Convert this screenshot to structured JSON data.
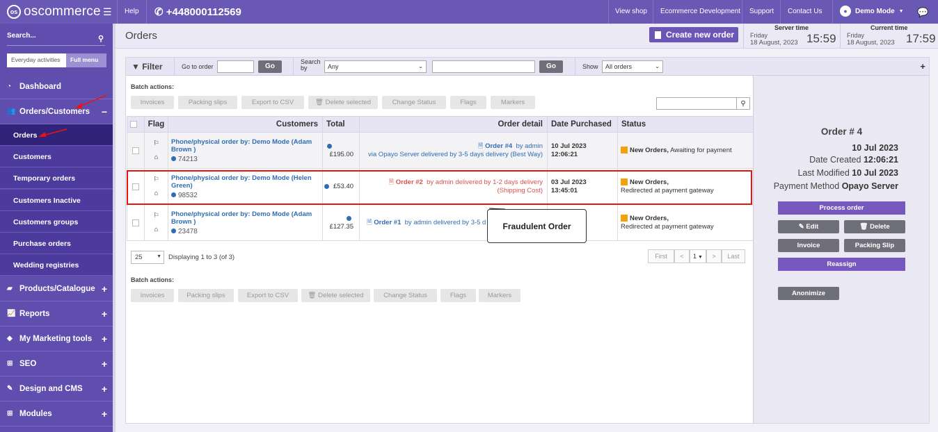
{
  "topbar": {
    "brand": "oscommerce",
    "help": "Help",
    "phone": "+448000112569",
    "links": [
      "View shop",
      "Ecommerce Development",
      "Support",
      "Contact Us"
    ],
    "user": "Demo Mode"
  },
  "sidebar": {
    "search_label": "Search...",
    "tabs": [
      "Everyday activities",
      "Full menu"
    ],
    "dashboard": "Dashboard",
    "orders_customers": "Orders/Customers",
    "subitems": [
      "Orders",
      "Customers",
      "Temporary orders",
      "Customers Inactive",
      "Customers groups",
      "Purchase orders",
      "Wedding registries"
    ],
    "sections": [
      "Products/Catalogue",
      "Reports",
      "My Marketing tools",
      "SEO",
      "Design and CMS",
      "Modules"
    ]
  },
  "header": {
    "title": "Orders",
    "create_button": "Create new order",
    "server_time": {
      "label": "Server time",
      "day": "Friday",
      "date": "18 August, 2023",
      "time": "15:59"
    },
    "current_time": {
      "label": "Current time",
      "day": "Friday",
      "date": "18 August, 2023",
      "time": "17:59"
    }
  },
  "filter": {
    "label": "Filter",
    "go_to_order": "Go to order",
    "go": "Go",
    "search_by_line1": "Search",
    "search_by_line2": "by",
    "search_by_value": "Any",
    "show": "Show",
    "show_value": "All orders"
  },
  "batch": {
    "label": "Batch actions:",
    "buttons": [
      "Invoices",
      "Packing slips",
      "Export to CSV",
      "Delete selected",
      "Change Status",
      "Flags",
      "Markers"
    ]
  },
  "table": {
    "headers": [
      "Flag",
      "Customers",
      "Total",
      "Order detail",
      "Date Purchased",
      "Status"
    ],
    "rows": [
      {
        "cust1": "Phone/physical order by: Demo Mode (Adam",
        "cust2": "Brown )",
        "cust_id": "74213",
        "total": "£195.00",
        "order_no": "Order #4",
        "detail1": "by admin",
        "detail2": "via Opayo Server delivered by 3-5 days delivery (Best Way)",
        "date": "10 Jul 2023",
        "time": "12:06:21",
        "status": "New Orders,",
        "status_note": "Awaiting for payment"
      },
      {
        "cust1": "Phone/physical order by: Demo Mode (Helen",
        "cust2": "Green)",
        "cust_id": "98532",
        "total": "£53.40",
        "order_no": "Order #2",
        "detail1": "by admin delivered by 1-2 days delivery",
        "detail2": "(Shipping Cost)",
        "date": "03 Jul 2023",
        "time": "13:45:01",
        "status": "New Orders,",
        "status_note": "Redirected at payment gateway"
      },
      {
        "cust1": "Phone/physical order by: Demo Mode (Adam",
        "cust2": "Brown )",
        "cust_id": "23478",
        "total": "£127.35",
        "order_no": "Order #1",
        "detail1": "by admin delivered by 3-5 d",
        "detail2": "",
        "date": "",
        "time": "",
        "status": "New Orders,",
        "status_note": "Redirected at payment gateway"
      }
    ]
  },
  "callout": "Fraudulent Order",
  "pager": {
    "per_page": "25",
    "displaying": "Displaying 1 to 3 (of 3)",
    "first": "First",
    "prev": "<",
    "page": "1",
    "next": ">",
    "last": "Last"
  },
  "panel": {
    "order_title": "Order # 4",
    "date_line": "10 Jul 2023",
    "date_created_label": "Date Created",
    "date_created": "12:06:21",
    "last_modified_label": "Last Modified",
    "last_modified": "10 Jul 2023",
    "payment_label": "Payment Method",
    "payment": "Opayo Server",
    "buttons": {
      "process": "Process order",
      "edit": "Edit",
      "delete": "Delete",
      "invoice": "Invoice",
      "packing": "Packing Slip",
      "reassign": "Reassign",
      "anonimize": "Anonimize"
    }
  },
  "colors": {
    "brand": "#6958b4",
    "sidebar": "#5f4eae",
    "status_new": "#f0a30a",
    "link": "#2f6db3",
    "alert": "#e11111"
  }
}
